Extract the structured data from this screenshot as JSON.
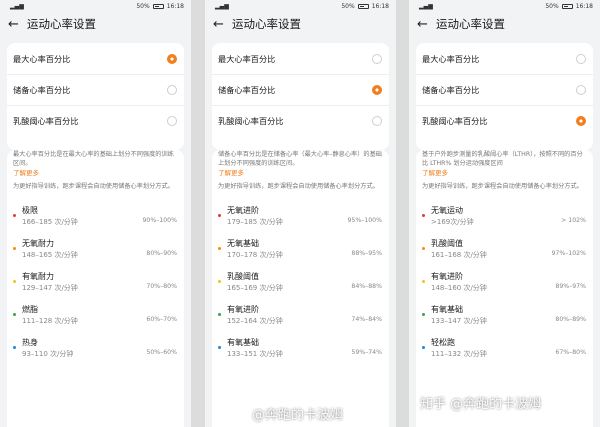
{
  "screens": [
    {
      "status": {
        "time": "16:18",
        "battery": "50%"
      },
      "header": {
        "title": "运动心率设置"
      },
      "options": [
        {
          "label": "最大心率百分比",
          "selected": true
        },
        {
          "label": "储备心率百分比",
          "selected": false
        },
        {
          "label": "乳酸阈心率百分比",
          "selected": false
        }
      ],
      "description": "最大心率百分比是在最大心率的基础上划分不同强度的训练区间。",
      "learn_more": "了解更多",
      "hint": "为更好指导训练，跑步课程会自动使用储备心率划分方式。",
      "zones": [
        {
          "name": "极限",
          "range": "166–185 次/分钟",
          "pct": "90%–100%",
          "color": "#e53935"
        },
        {
          "name": "无氧耐力",
          "range": "148–165 次/分钟",
          "pct": "80%–90%",
          "color": "#fb8c00"
        },
        {
          "name": "有氧耐力",
          "range": "129–147 次/分钟",
          "pct": "70%–80%",
          "color": "#f6c026"
        },
        {
          "name": "燃脂",
          "range": "111–128 次/分钟",
          "pct": "60%–70%",
          "color": "#43a047"
        },
        {
          "name": "热身",
          "range": "93–110 次/分钟",
          "pct": "50%–60%",
          "color": "#1e88e5"
        }
      ]
    },
    {
      "status": {
        "time": "16:18",
        "battery": "50%"
      },
      "header": {
        "title": "运动心率设置"
      },
      "options": [
        {
          "label": "最大心率百分比",
          "selected": false
        },
        {
          "label": "储备心率百分比",
          "selected": true
        },
        {
          "label": "乳酸阈心率百分比",
          "selected": false
        }
      ],
      "description": "储备心率百分比是在储备心率（最大心率–静息心率）的基础上划分不同强度的训练区间。",
      "learn_more": "了解更多",
      "hint": "为更好指导训练，跑步课程会自动使用储备心率划分方式。",
      "zones": [
        {
          "name": "无氧进阶",
          "range": "179–185 次/分钟",
          "pct": "95%–100%",
          "color": "#e53935"
        },
        {
          "name": "无氧基础",
          "range": "170–178 次/分钟",
          "pct": "88%–95%",
          "color": "#fb8c00"
        },
        {
          "name": "乳酸阈值",
          "range": "165–169 次/分钟",
          "pct": "84%–88%",
          "color": "#f6c026"
        },
        {
          "name": "有氧进阶",
          "range": "152–164 次/分钟",
          "pct": "74%–84%",
          "color": "#43a047"
        },
        {
          "name": "有氧基础",
          "range": "133–151 次/分钟",
          "pct": "59%–74%",
          "color": "#1e88e5"
        }
      ]
    },
    {
      "status": {
        "time": "16:18",
        "battery": "50%"
      },
      "header": {
        "title": "运动心率设置"
      },
      "options": [
        {
          "label": "最大心率百分比",
          "selected": false
        },
        {
          "label": "储备心率百分比",
          "selected": false
        },
        {
          "label": "乳酸阈心率百分比",
          "selected": true
        }
      ],
      "description": "基于户外跑步测量的乳酸阈心率（LTHR），按照不同的百分比 LTHR% 划分运动强度区间",
      "learn_more": "了解更多",
      "hint": "为更好指导训练，跑步课程会自动使用储备心率划分方式。",
      "zones": [
        {
          "name": "无氧运动",
          "range": ">169次/分钟",
          "pct": "> 102%",
          "color": "#e53935"
        },
        {
          "name": "乳酸阈值",
          "range": "161–168 次/分钟",
          "pct": "97%–102%",
          "color": "#fb8c00"
        },
        {
          "name": "有氧进阶",
          "range": "148–160 次/分钟",
          "pct": "89%–97%",
          "color": "#f6c026"
        },
        {
          "name": "有氧基础",
          "range": "133–147 次/分钟",
          "pct": "80%–89%",
          "color": "#43a047"
        },
        {
          "name": "轻松跑",
          "range": "111–132 次/分钟",
          "pct": "67%–80%",
          "color": "#1e88e5"
        }
      ]
    }
  ],
  "watermarks": [
    "@奔跑的卡波姆",
    "知乎 @奔跑的卡波姆"
  ]
}
